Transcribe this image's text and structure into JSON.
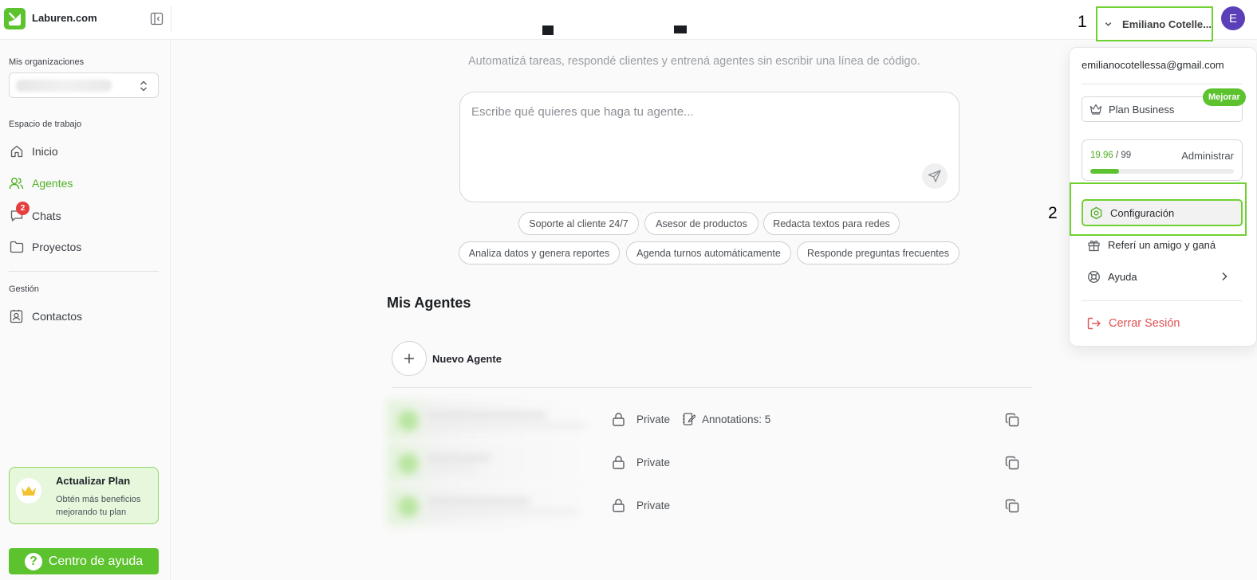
{
  "app": {
    "brand": "Laburen.com"
  },
  "annotations": {
    "one": "1",
    "two": "2"
  },
  "user": {
    "name": "Emiliano Cotelle...",
    "avatar_letter": "E",
    "email": "emilianocotellessa@gmail.com"
  },
  "sidebar": {
    "orgs_label": "Mis organizaciones",
    "workspace_label": "Espacio de trabajo",
    "management_label": "Gestión",
    "items": [
      {
        "label": "Inicio",
        "icon": "home-icon"
      },
      {
        "label": "Agentes",
        "icon": "users-icon",
        "active": true
      },
      {
        "label": "Chats",
        "icon": "chat-icon",
        "badge": "2"
      },
      {
        "label": "Proyectos",
        "icon": "folder-icon"
      },
      {
        "label": "Contactos",
        "icon": "contact-icon"
      }
    ],
    "upgrade": {
      "title": "Actualizar Plan",
      "desc": "Obtén más beneficios mejorando tu plan"
    },
    "help_center": "Centro de ayuda"
  },
  "main": {
    "subtitle": "Automatizá tareas, respondé clientes y entrená agentes sin escribir una línea de código.",
    "prompt_placeholder": "Escribe qué quieres que haga tu agente...",
    "chips": [
      "Soporte al cliente 24/7",
      "Asesor de productos",
      "Redacta textos para redes",
      "Analiza datos y genera reportes",
      "Agenda turnos automáticamente",
      "Responde preguntas frecuentes"
    ],
    "agents_title": "Mis Agentes",
    "new_agent": "Nuevo Agente",
    "agents": [
      {
        "visibility": "Private",
        "annotations": "Annotations: 5"
      },
      {
        "visibility": "Private"
      },
      {
        "visibility": "Private"
      }
    ]
  },
  "menu": {
    "plan": "Plan Business",
    "upgrade_badge": "Mejorar",
    "usage_used": "19.96",
    "usage_total": " / 99",
    "usage_fraction": 0.2016,
    "manage": "Administrar",
    "config": "Configuración",
    "refer": "Referí un amigo y ganá",
    "help": "Ayuda",
    "logout": "Cerrar Sesión"
  },
  "colors": {
    "accent": "#5cc22e",
    "avatar": "#5b3fb8",
    "danger": "#e05252",
    "highlight": "#6fd130"
  }
}
